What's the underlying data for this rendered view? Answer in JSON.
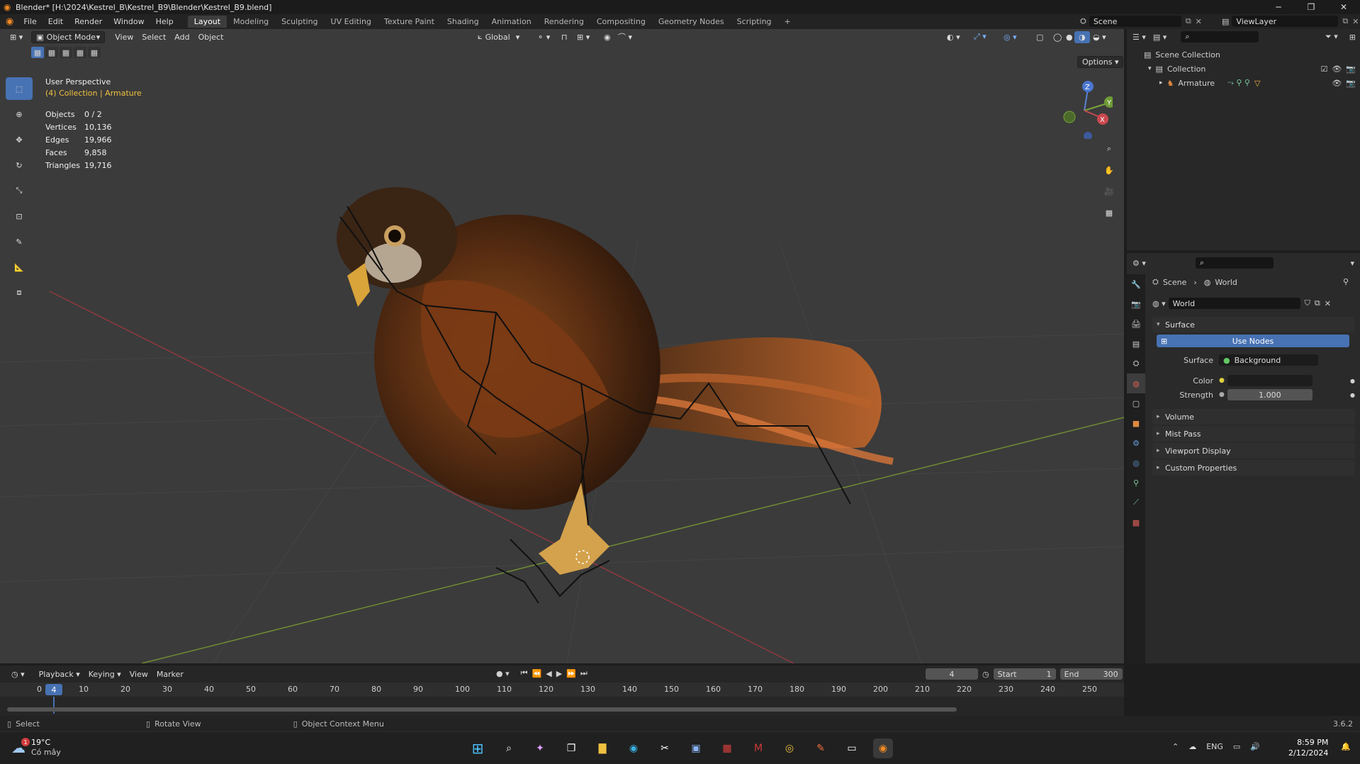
{
  "titlebar": {
    "title": "Blender* [H:\\2024\\Kestrel_B\\Kestrel_B9\\Blender\\Kestrel_B9.blend]",
    "minimize": "─",
    "maximize": "❐",
    "close": "✕"
  },
  "menubar": {
    "menus": [
      "File",
      "Edit",
      "Render",
      "Window",
      "Help"
    ],
    "workspaces": [
      "Layout",
      "Modeling",
      "Sculpting",
      "UV Editing",
      "Texture Paint",
      "Shading",
      "Animation",
      "Rendering",
      "Compositing",
      "Geometry Nodes",
      "Scripting"
    ],
    "add_workspace": "+",
    "scene_name": "Scene",
    "view_layer": "ViewLayer"
  },
  "viewport": {
    "mode": "Object Mode",
    "menus": [
      "View",
      "Select",
      "Add",
      "Object"
    ],
    "transform_orientation": "Global",
    "options_label": "Options",
    "view_name": "User Perspective",
    "collection_info": "(4) Collection | Armature",
    "stats": [
      {
        "label": "Objects",
        "value": "0 / 2"
      },
      {
        "label": "Vertices",
        "value": "10,136"
      },
      {
        "label": "Edges",
        "value": "19,966"
      },
      {
        "label": "Faces",
        "value": "9,858"
      },
      {
        "label": "Triangles",
        "value": "19,716"
      }
    ],
    "gizmo": {
      "z": "Z",
      "y": "Y",
      "x": "X"
    }
  },
  "outliner": {
    "root": "Scene Collection",
    "collection": "Collection",
    "item": "Armature"
  },
  "properties": {
    "breadcrumb_scene": "Scene",
    "breadcrumb_world": "World",
    "world_name": "World",
    "surface_panel": "Surface",
    "use_nodes": "Use Nodes",
    "surface_label": "Surface",
    "surface_value": "Background",
    "color_label": "Color",
    "strength_label": "Strength",
    "strength_value": "1.000",
    "panels": [
      "Volume",
      "Mist Pass",
      "Viewport Display",
      "Custom Properties"
    ]
  },
  "timeline": {
    "menus": [
      "Playback",
      "Keying",
      "View",
      "Marker"
    ],
    "current_frame": "4",
    "start_label": "Start",
    "start_value": "1",
    "end_label": "End",
    "end_value": "300",
    "ticks": [
      "0",
      "10",
      "20",
      "30",
      "40",
      "50",
      "60",
      "70",
      "80",
      "90",
      "100",
      "110",
      "120",
      "130",
      "140",
      "150",
      "160",
      "170",
      "180",
      "190",
      "200",
      "210",
      "220",
      "230",
      "240",
      "250"
    ],
    "cursor_label": "4"
  },
  "statusbar": {
    "select": "Select",
    "rotate": "Rotate View",
    "context": "Object Context Menu",
    "version": "3.6.2"
  },
  "taskbar": {
    "weather_temp": "19°C",
    "weather_desc": "Có mây",
    "weather_badge": "1",
    "lang": "ENG",
    "time": "8:59 PM",
    "date": "2/12/2024"
  },
  "colors": {
    "accent": "#4772b3",
    "viewport_bg": "#3b3b3b",
    "x_axis": "#c9484e",
    "y_axis": "#7aa33b",
    "highlight_text": "#f0c040"
  }
}
